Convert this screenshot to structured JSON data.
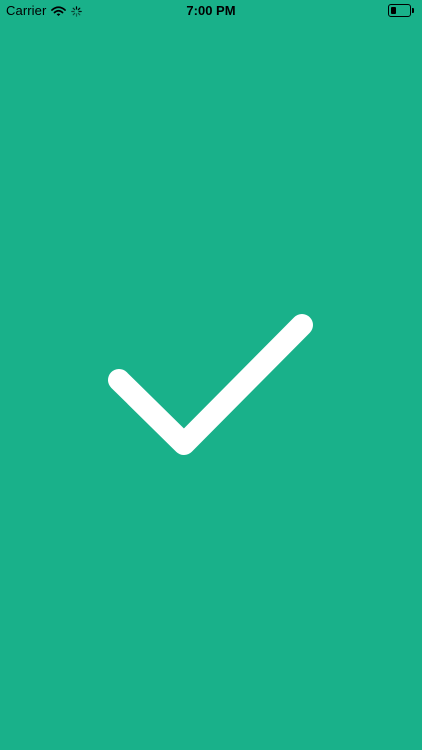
{
  "status_bar": {
    "carrier": "Carrier",
    "time": "7:00 PM",
    "battery_level": 0.3
  },
  "icons": {
    "wifi": "wifi-icon",
    "activity": "activity-spinner-icon",
    "battery": "battery-icon",
    "success": "checkmark-icon"
  },
  "colors": {
    "background": "#19B18A",
    "checkmark": "#FFFFFF",
    "status_text": "#000000"
  }
}
